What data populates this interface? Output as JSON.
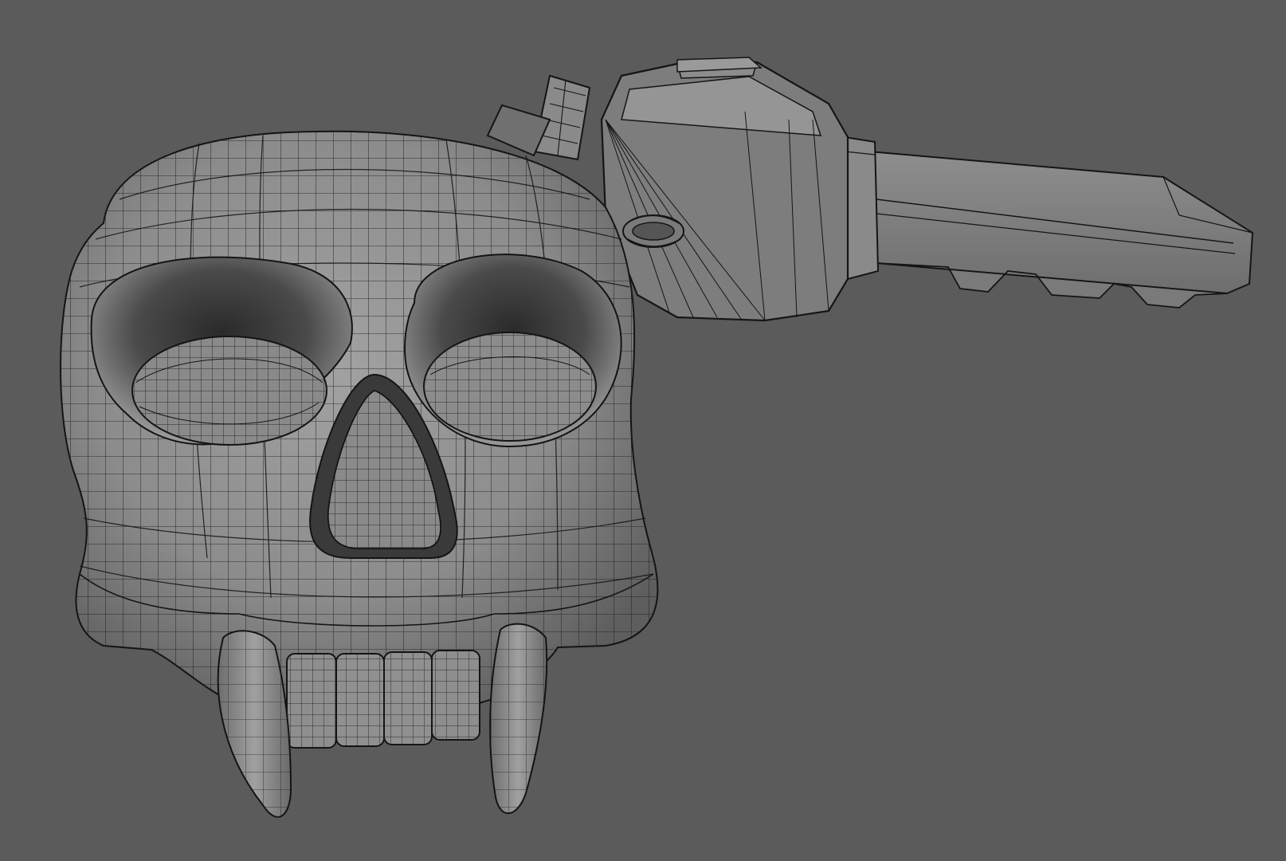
{
  "viewport": {
    "background_color": "#5b5b5b",
    "mesh_color": "#8a8a8a",
    "wire_color": "#1a1a1a",
    "shade_dark": "#2e2e2e",
    "shade_light": "#a8a8a8"
  },
  "scene": {
    "objects": [
      "skull-keychain-mesh",
      "key-mesh",
      "key-ring-mesh"
    ]
  }
}
